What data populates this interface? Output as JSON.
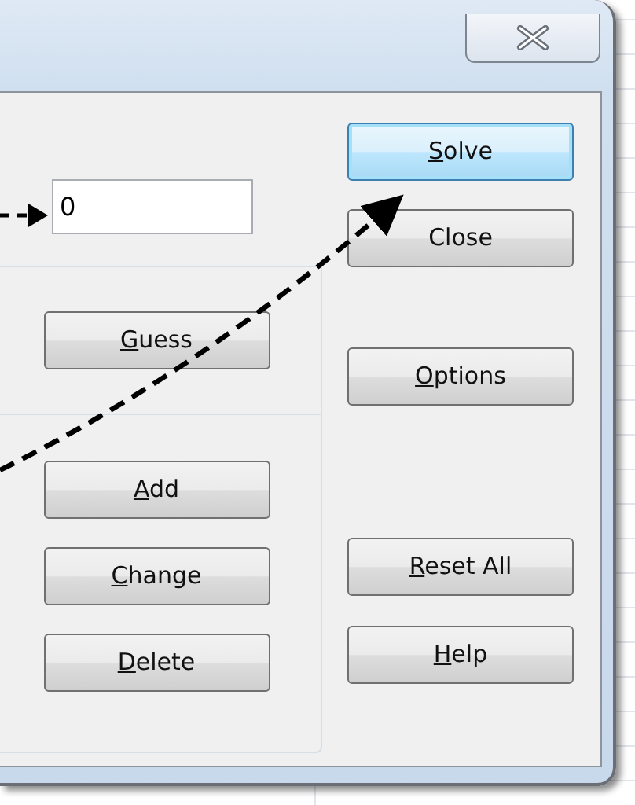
{
  "target_field": {
    "value": "0"
  },
  "guess_group": {
    "buttons": [
      {
        "label_parts": [
          {
            "text": "G",
            "underlined": true
          },
          {
            "text": "uess",
            "underlined": false
          }
        ]
      }
    ]
  },
  "constraint_group": {
    "buttons": [
      {
        "label_parts": [
          {
            "text": "A",
            "underlined": true
          },
          {
            "text": "dd",
            "underlined": false
          }
        ]
      },
      {
        "label_parts": [
          {
            "text": "C",
            "underlined": true
          },
          {
            "text": "hange",
            "underlined": false
          }
        ]
      },
      {
        "label_parts": [
          {
            "text": "D",
            "underlined": true
          },
          {
            "text": "elete",
            "underlined": false
          }
        ]
      }
    ]
  },
  "right_buttons": [
    {
      "focused": true,
      "label_parts": [
        {
          "text": "S",
          "underlined": true
        },
        {
          "text": "olve",
          "underlined": false
        }
      ]
    },
    {
      "focused": false,
      "label_parts": [
        {
          "text": "Close",
          "underlined": false
        }
      ]
    },
    {
      "focused": false,
      "label_parts": [
        {
          "text": "O",
          "underlined": true
        },
        {
          "text": "ptions",
          "underlined": false
        }
      ]
    },
    {
      "focused": false,
      "label_parts": [
        {
          "text": "R",
          "underlined": true
        },
        {
          "text": "eset All",
          "underlined": false
        }
      ]
    },
    {
      "focused": false,
      "label_parts": [
        {
          "text": "H",
          "underlined": true
        },
        {
          "text": "elp",
          "underlined": false
        }
      ]
    }
  ]
}
